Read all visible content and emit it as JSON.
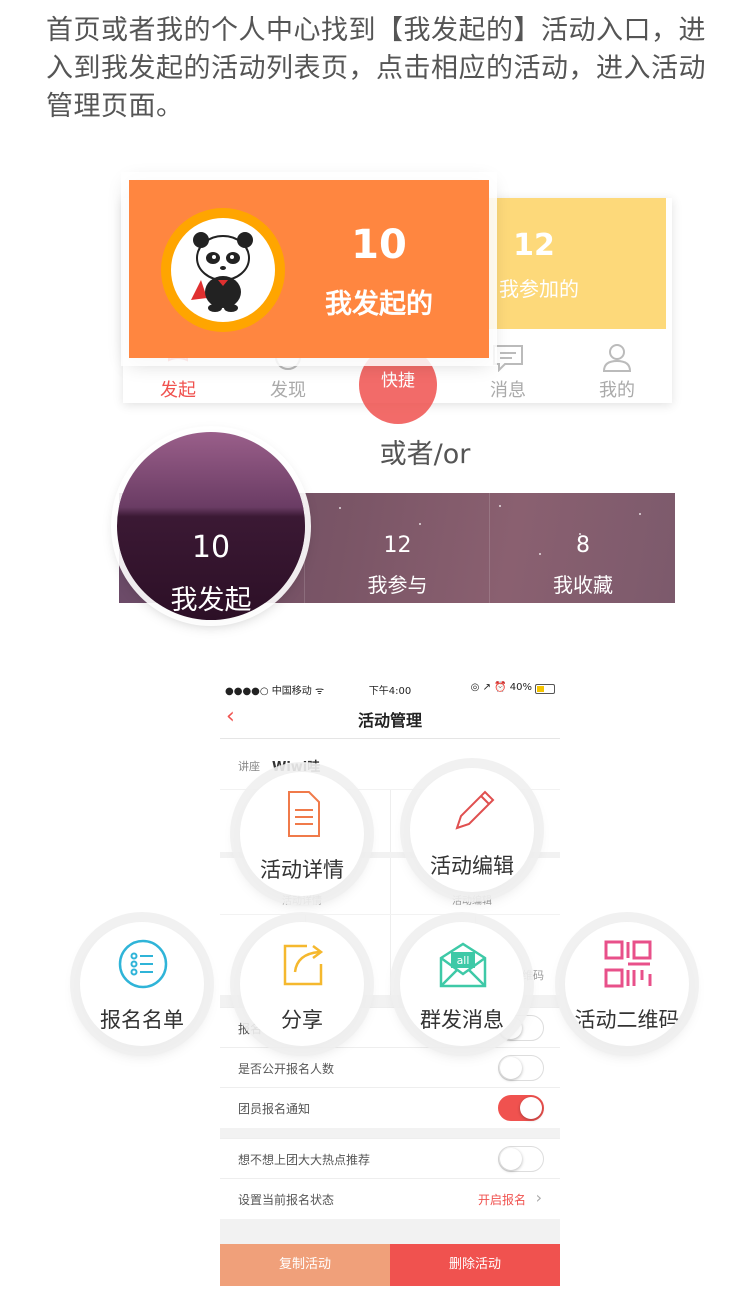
{
  "intro": "首页或者我的个人中心找到【我发起的】活动入口，进入到我发起的活动列表页，点击相应的活动，进入活动管理页面。",
  "section1": {
    "highlight": {
      "count": "10",
      "label": "我发起的"
    },
    "joined": {
      "count": "12",
      "label": "我参加的"
    },
    "tabs": [
      {
        "label": "发起",
        "icon": "flag-icon"
      },
      {
        "label": "发现",
        "icon": "discover-icon"
      },
      {
        "label": "快捷",
        "icon": "pen-icon"
      },
      {
        "label": "消息",
        "icon": "message-icon"
      },
      {
        "label": "我的",
        "icon": "user-icon"
      }
    ]
  },
  "or_text": "或者/or",
  "section2": {
    "highlight": {
      "count": "10",
      "label": "我发起"
    },
    "stats": [
      {
        "count": "12",
        "label": "我参与"
      },
      {
        "count": "8",
        "label": "我收藏"
      }
    ]
  },
  "phone": {
    "status": {
      "carrier": "●●●●○ 中国移动 ᯤ",
      "time": "下午4:00",
      "right": "◎ ↗ ⏰ 40%"
    },
    "title": "活动管理",
    "meta_key": "讲座",
    "meta_value": "Wiwi哇",
    "grid_labels": [
      "活动详情",
      "活动编辑"
    ],
    "grid3_partial": [
      "报",
      "维码"
    ],
    "rows": [
      {
        "label": "报名",
        "on": false
      },
      {
        "label": "是否公开报名人数",
        "on": false
      },
      {
        "label": "团员报名通知",
        "on": true
      }
    ],
    "rows2": [
      {
        "label": "想不想上团大大热点推荐",
        "on": false
      }
    ],
    "status_row": {
      "label": "设置当前报名状态",
      "value": "开启报名"
    },
    "buttons": {
      "copy": "复制活动",
      "delete": "删除活动"
    }
  },
  "bubbles": [
    {
      "label": "活动详情",
      "icon": "document-icon"
    },
    {
      "label": "活动编辑",
      "icon": "pencil-icon"
    },
    {
      "label": "报名名单",
      "icon": "list-icon"
    },
    {
      "label": "分享",
      "icon": "share-icon"
    },
    {
      "label": "群发消息",
      "icon": "mail-all-icon"
    },
    {
      "label": "活动二维码",
      "icon": "qr-code-icon"
    }
  ],
  "colors": {
    "orange": "#ff8640",
    "yellow": "#fdd97a",
    "red": "#f0524f",
    "copy_button": "#f0a07a"
  }
}
